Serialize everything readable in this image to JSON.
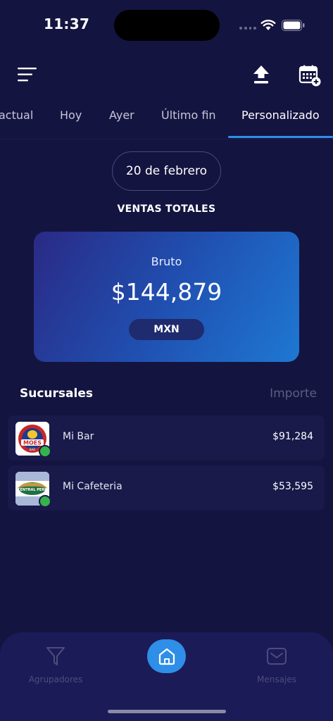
{
  "status_bar": {
    "time": "11:37"
  },
  "top_bar": {
    "menu_icon": "menu-icon",
    "upload_icon": "upload-icon",
    "calendar_icon": "calendar-add-icon"
  },
  "tabs": [
    {
      "label": "actual",
      "active": false
    },
    {
      "label": "Hoy",
      "active": false
    },
    {
      "label": "Ayer",
      "active": false
    },
    {
      "label": "Último fin",
      "active": false
    },
    {
      "label": "Personalizado",
      "active": true
    }
  ],
  "date_filter": {
    "label": "20 de febrero"
  },
  "sales": {
    "section_title": "VENTAS TOTALES",
    "label": "Bruto",
    "amount": "$144,879",
    "currency": "MXN"
  },
  "branches": {
    "title": "Sucursales",
    "column_label": "Importe",
    "items": [
      {
        "name": "Mi Bar",
        "amount": "$91,284",
        "logo_text": "MOES",
        "logo_subtext": "BAR"
      },
      {
        "name": "Mi Cafeteria",
        "amount": "$53,595",
        "logo_text": "CENTRAL PERK",
        "logo_subtext": ""
      }
    ]
  },
  "bottom_nav": {
    "items": [
      {
        "label": "Agrupadores",
        "icon": "filter-icon"
      },
      {
        "label": "",
        "icon": "home-icon"
      },
      {
        "label": "Mensajes",
        "icon": "mail-icon"
      }
    ]
  },
  "colors": {
    "background": "#141440",
    "accent": "#2f8fe8",
    "online": "#36b34a",
    "card_gradient_start": "#2a2a85",
    "card_gradient_end": "#1e78d2"
  }
}
